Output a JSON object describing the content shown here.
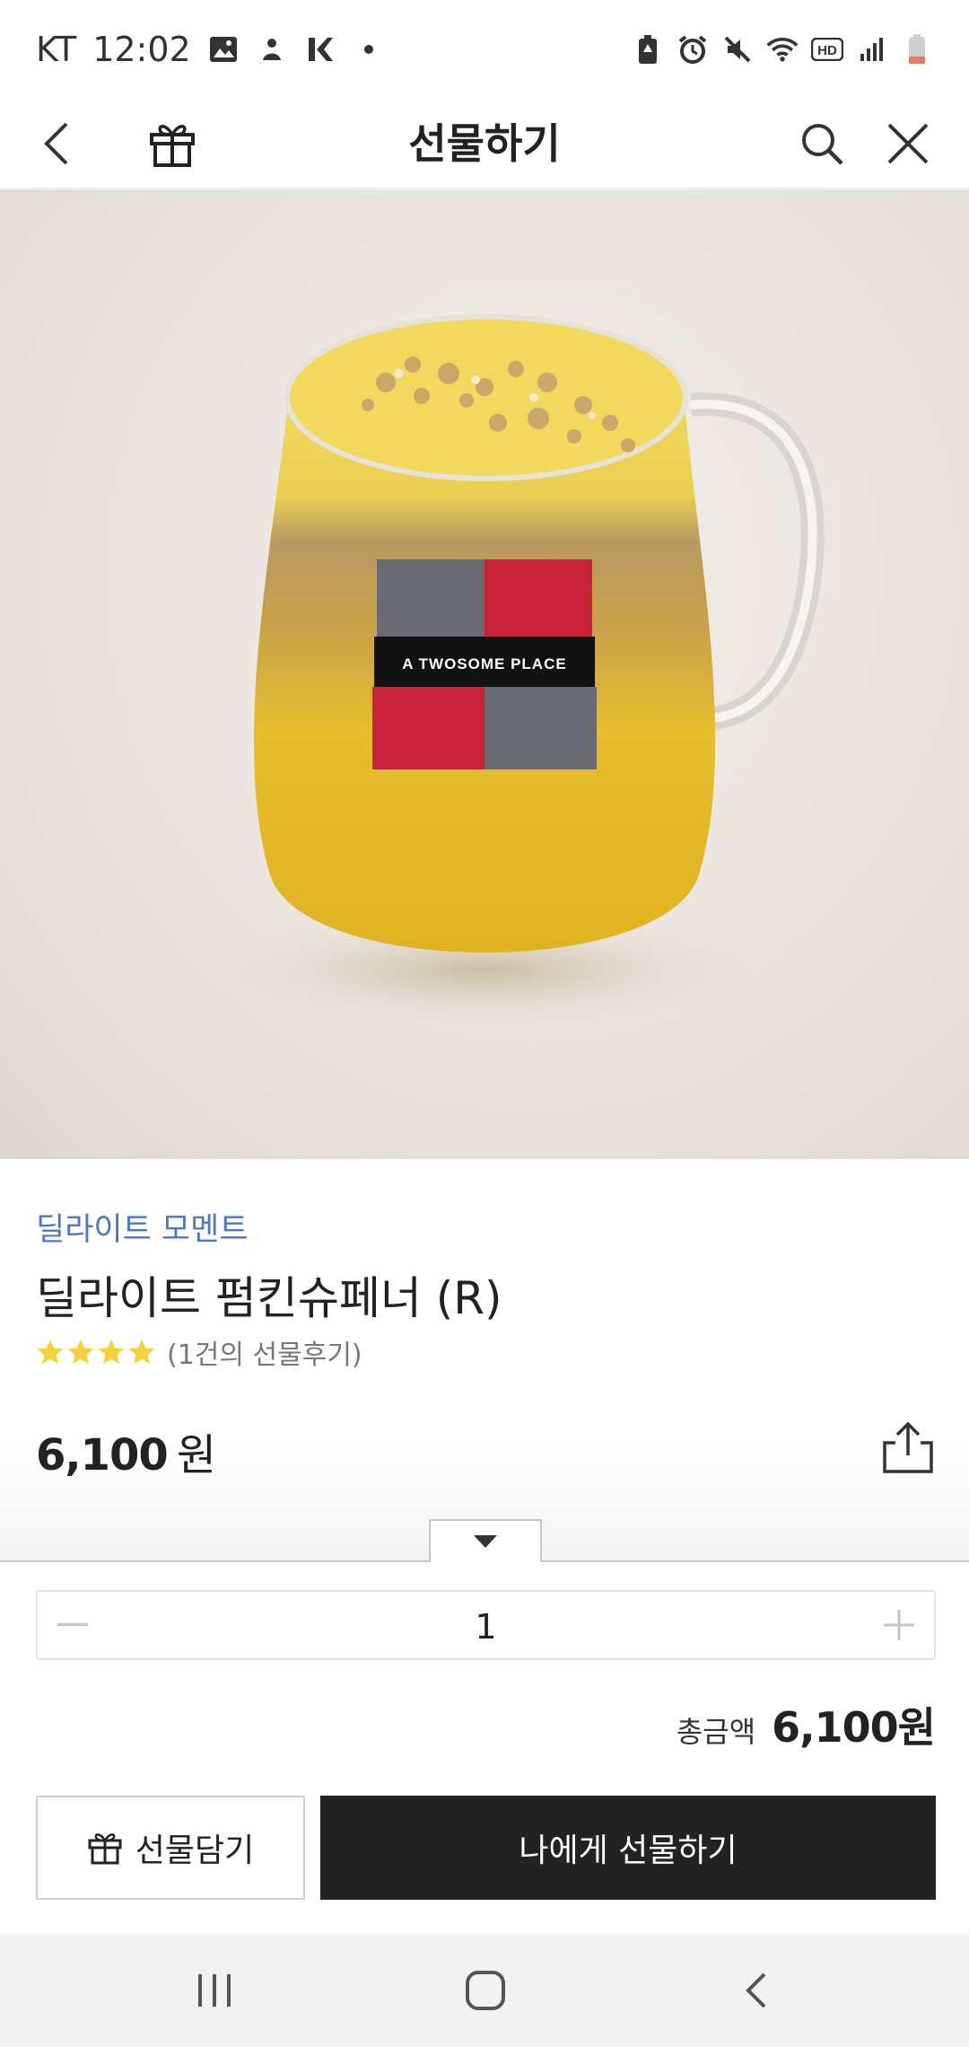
{
  "status_bar": {
    "carrier": "KT",
    "time": "12:02"
  },
  "header": {
    "title": "선물하기",
    "icons": [
      "back-icon",
      "gift-icon",
      "search-icon",
      "close-icon"
    ]
  },
  "product_image": {
    "cup_logo_text": "A TWOSOME PLACE"
  },
  "product": {
    "brand": "딜라이트 모멘트",
    "name": "딜라이트 펌킨슈페너 (R)",
    "rating_stars": 4,
    "review_text": "(1건의 선물후기)",
    "price_value": "6,100",
    "price_unit": "원"
  },
  "quantity": {
    "value": "1"
  },
  "total": {
    "label": "총금액",
    "value": "6,100원"
  },
  "actions": {
    "cart_label": "선물담기",
    "gift_label": "나에게 선물하기"
  },
  "colors": {
    "brand_link": "#4a78c6",
    "star": "#f5d13a",
    "primary_button": "#222222"
  }
}
